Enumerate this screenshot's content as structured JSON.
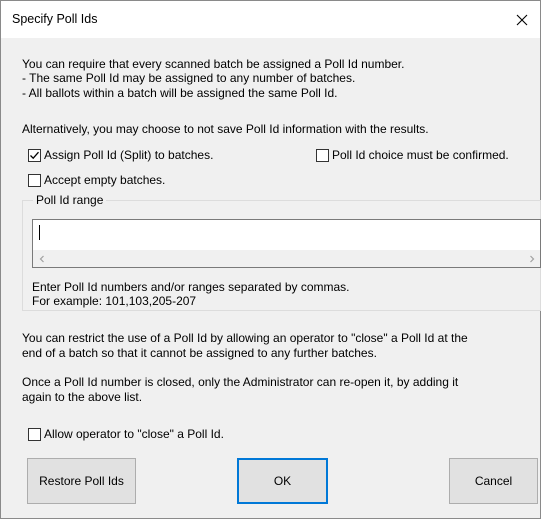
{
  "window": {
    "title": "Specify Poll Ids"
  },
  "intro": {
    "line1": "You can require that every scanned batch be assigned a Poll Id number.",
    "line2": " - The same Poll Id may be assigned to any number of batches.",
    "line3": " - All ballots within a batch will be assigned the same Poll Id.",
    "alternative": "Alternatively, you may choose to not save Poll Id information with the results."
  },
  "options": {
    "assign_split": {
      "label": "Assign Poll Id (Split) to batches.",
      "checked": true
    },
    "must_confirm": {
      "label": "Poll Id choice must be confirmed.",
      "checked": false
    },
    "accept_empty": {
      "label": "Accept empty batches.",
      "checked": false
    }
  },
  "range": {
    "group_label": "Poll Id range",
    "value": "",
    "hint1": "Enter Poll Id numbers and/or ranges separated by commas.",
    "hint2": "For example: 101,103,205-207"
  },
  "close_info": {
    "line1": "You can restrict the use of a Poll Id by allowing an operator to \"close\" a Poll Id at the",
    "line2": "end of a batch so that it cannot be assigned to any further batches.",
    "line3": "Once a Poll Id number is closed, only the Administrator can re-open it, by adding it",
    "line4": "again to the above list."
  },
  "allow_close": {
    "label": "Allow operator to \"close\" a Poll Id.",
    "checked": false
  },
  "buttons": {
    "restore": "Restore Poll Ids",
    "ok": "OK",
    "cancel": "Cancel"
  },
  "colors": {
    "accent": "#0078d7",
    "dialog_bg": "#f0f0f0",
    "button_bg": "#e1e1e1"
  }
}
